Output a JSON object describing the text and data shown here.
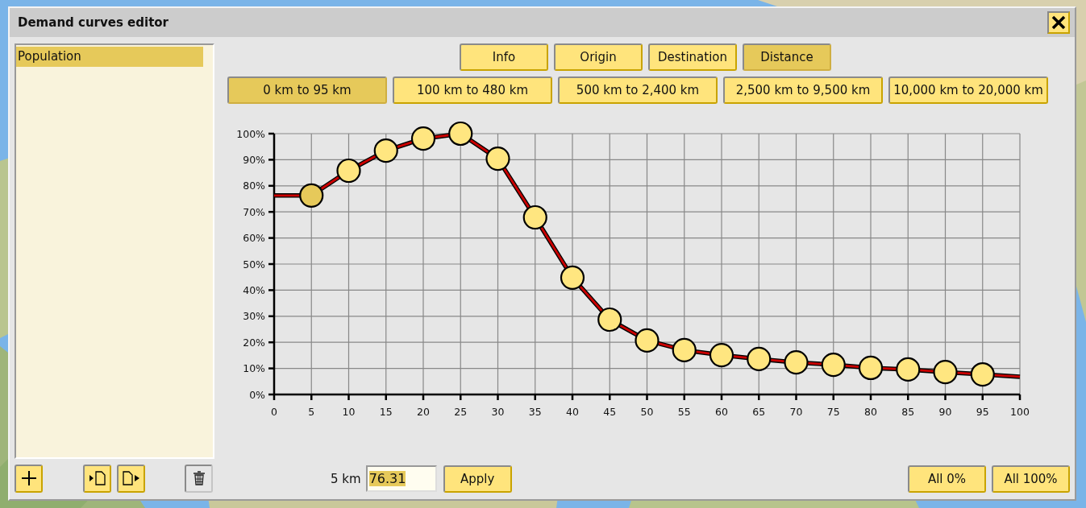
{
  "window": {
    "title": "Demand curves editor"
  },
  "curves": [
    {
      "label": "Population",
      "selected": true
    }
  ],
  "tabs": [
    {
      "label": "Info",
      "selected": false
    },
    {
      "label": "Origin",
      "selected": false
    },
    {
      "label": "Destination",
      "selected": false
    },
    {
      "label": "Distance",
      "selected": true
    }
  ],
  "ranges": [
    {
      "label": "0 km to 95 km",
      "selected": true
    },
    {
      "label": "100 km to 480 km",
      "selected": false
    },
    {
      "label": "500 km to 2,400 km",
      "selected": false
    },
    {
      "label": "2,500 km to 9,500 km",
      "selected": false
    },
    {
      "label": "10,000 km to 20,000 km",
      "selected": false
    }
  ],
  "chart": {
    "handles": [
      {
        "selected": true
      },
      {
        "selected": false
      },
      {
        "selected": false
      },
      {
        "selected": false
      },
      {
        "selected": false
      },
      {
        "selected": false
      },
      {
        "selected": false
      },
      {
        "selected": false
      },
      {
        "selected": false
      },
      {
        "selected": false
      },
      {
        "selected": false
      },
      {
        "selected": false
      },
      {
        "selected": false
      },
      {
        "selected": false
      },
      {
        "selected": false
      },
      {
        "selected": false
      },
      {
        "selected": false
      },
      {
        "selected": false
      },
      {
        "selected": false
      }
    ],
    "chart_data": {
      "type": "line",
      "grid": true,
      "x": [
        0,
        5,
        10,
        15,
        20,
        25,
        30,
        35,
        40,
        45,
        50,
        55,
        60,
        65,
        70,
        75,
        80,
        85,
        90,
        95,
        100
      ],
      "series": [
        {
          "color": "#cc0000",
          "marker": "circle",
          "values": [
            76.3,
            76.3,
            85.8,
            93.5,
            98.1,
            100,
            90.4,
            67.9,
            44.8,
            28.7,
            20.7,
            17.0,
            15.1,
            13.6,
            12.3,
            11.4,
            10.2,
            9.6,
            8.6,
            7.7,
            6.8
          ]
        }
      ],
      "xlim": [
        0,
        100
      ],
      "ylim": [
        0,
        100
      ],
      "xticks": [
        0,
        5,
        10,
        15,
        20,
        25,
        30,
        35,
        40,
        45,
        50,
        55,
        60,
        65,
        70,
        75,
        80,
        85,
        90,
        95,
        100
      ],
      "yticks": [
        {
          "value": 0,
          "label": "0%"
        },
        {
          "value": 10,
          "label": "10%"
        },
        {
          "value": 20,
          "label": "20%"
        },
        {
          "value": 30,
          "label": "30%"
        },
        {
          "value": 40,
          "label": "40%"
        },
        {
          "value": 50,
          "label": "50%"
        },
        {
          "value": 60,
          "label": "60%"
        },
        {
          "value": 70,
          "label": "70%"
        },
        {
          "value": 80,
          "label": "80%"
        },
        {
          "value": 90,
          "label": "90%"
        },
        {
          "value": 100,
          "label": "100%"
        }
      ]
    }
  },
  "editor": {
    "label": "5 km",
    "value": "76.31",
    "apply": "Apply"
  },
  "bulk_buttons": [
    "All 0%",
    "All 100%"
  ]
}
